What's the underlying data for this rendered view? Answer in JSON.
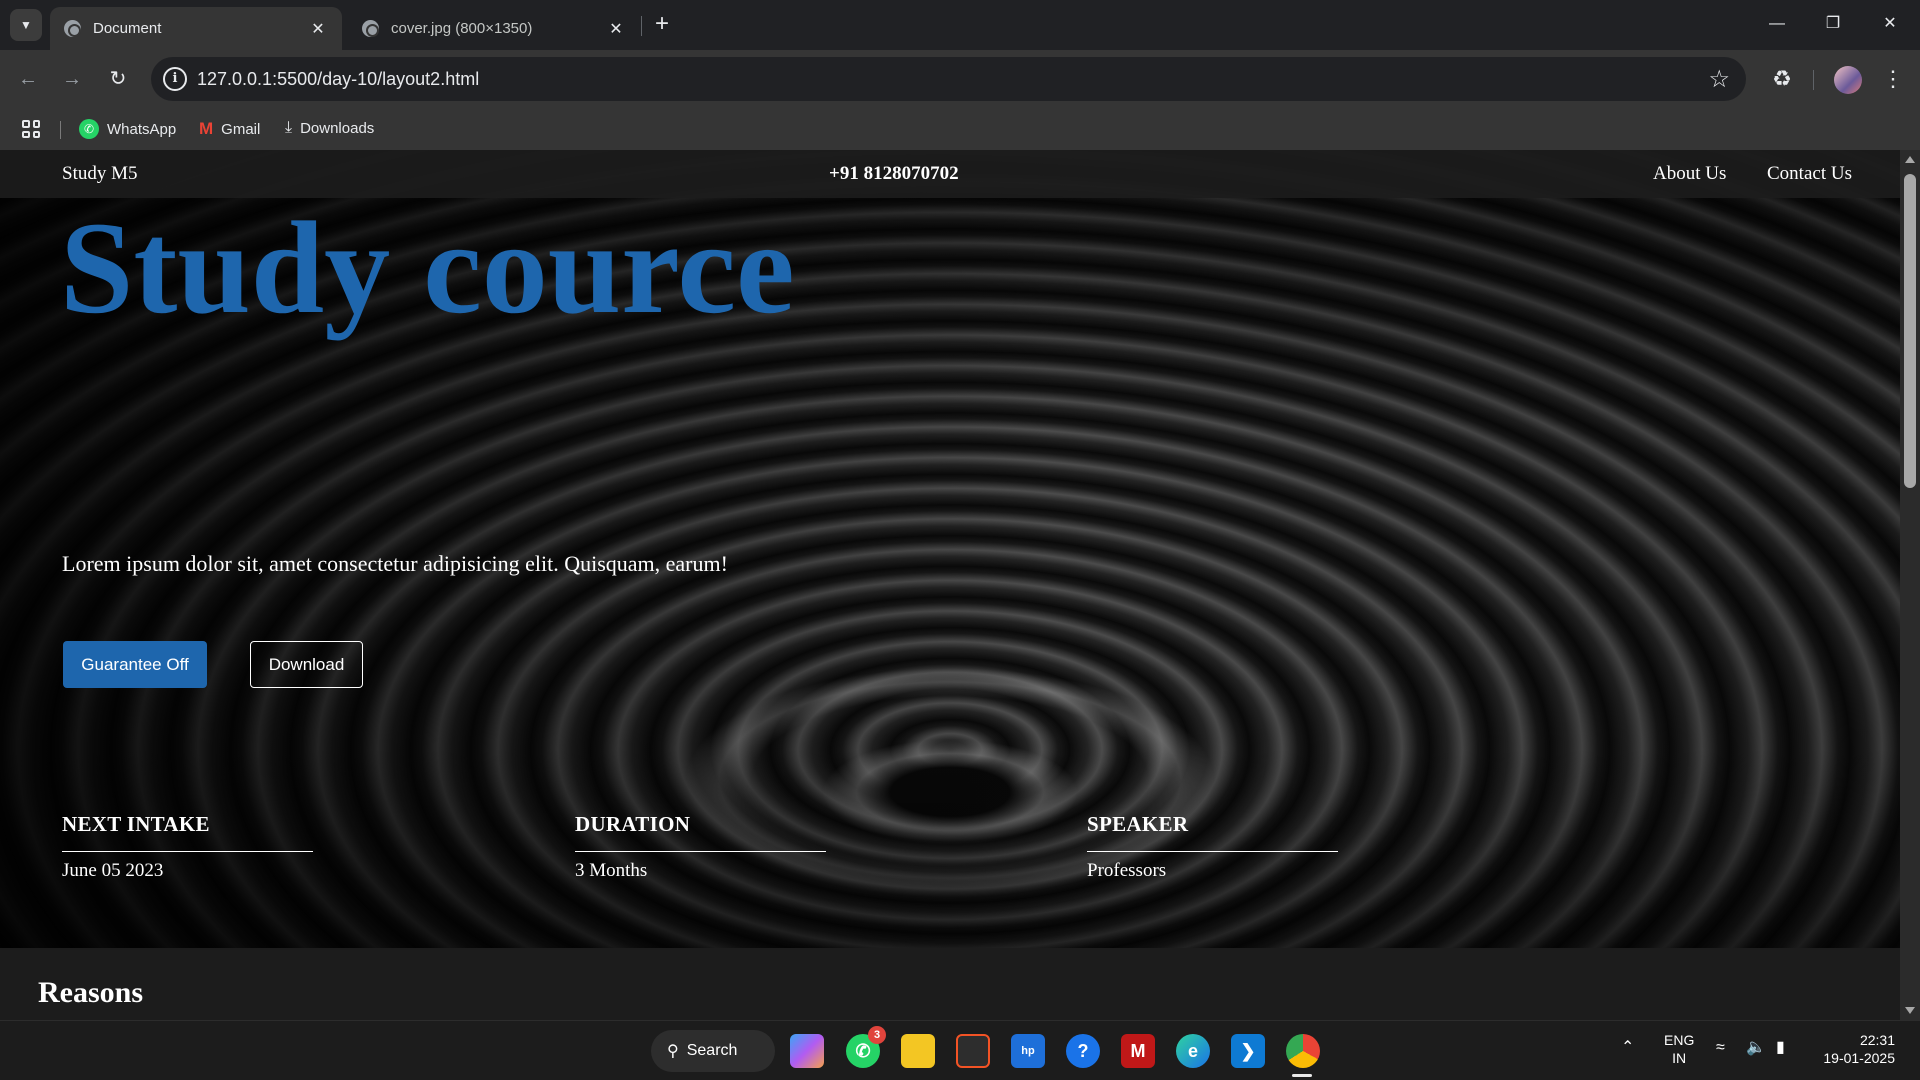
{
  "browser": {
    "tabs": [
      {
        "title": "Document",
        "active": true
      },
      {
        "title": "cover.jpg (800×1350)",
        "active": false
      }
    ],
    "url": "127.0.0.1:5500/day-10/layout2.html",
    "bookmarks": [
      {
        "label": "WhatsApp",
        "icon": "whatsapp-icon"
      },
      {
        "label": "Gmail",
        "icon": "gmail-icon"
      },
      {
        "label": "Downloads",
        "icon": "download-icon"
      }
    ]
  },
  "site": {
    "nav": {
      "brand": "Study M5",
      "phone": "+91 8128070702",
      "links": [
        "About Us",
        "Contact Us"
      ]
    },
    "hero": {
      "title": "Study cource",
      "text": "Lorem ipsum dolor sit, amet consectetur adipisicing elit. Quisquam, earum!",
      "primary_button": "Guarantee Off",
      "secondary_button": "Download"
    },
    "stats": [
      {
        "label": "NEXT INTAKE",
        "value": "June 05 2023"
      },
      {
        "label": "DURATION",
        "value": "3 Months"
      },
      {
        "label": "SPEAKER",
        "value": "Professors"
      }
    ],
    "section_heading": "Reasons",
    "colors": {
      "accent": "#1e66ad",
      "nav_bg": "#1c1c1c"
    }
  },
  "taskbar": {
    "search_label": "Search",
    "whatsapp_badge": "3",
    "language": {
      "line1": "ENG",
      "line2": "IN"
    },
    "time": "22:31",
    "date": "19-01-2025"
  }
}
